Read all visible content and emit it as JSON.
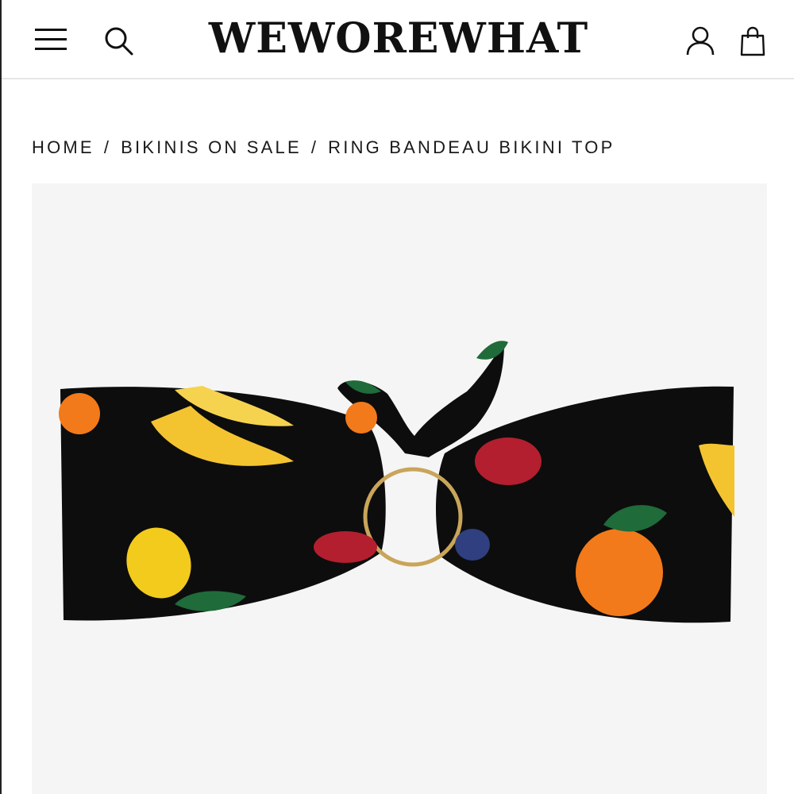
{
  "header": {
    "logo_text": "WEWOREWHAT",
    "icons": {
      "menu": "hamburger-menu-icon",
      "search": "search-icon",
      "account": "user-account-icon",
      "cart": "shopping-bag-icon"
    }
  },
  "breadcrumb": {
    "items": [
      "HOME",
      "BIKINIS ON SALE",
      "RING BANDEAU BIKINI TOP"
    ],
    "separator": "/"
  },
  "product": {
    "image_bg_color": "#f5f5f5",
    "fabric_color": "#0d0d0d",
    "ring_color": "#c9a55a"
  }
}
